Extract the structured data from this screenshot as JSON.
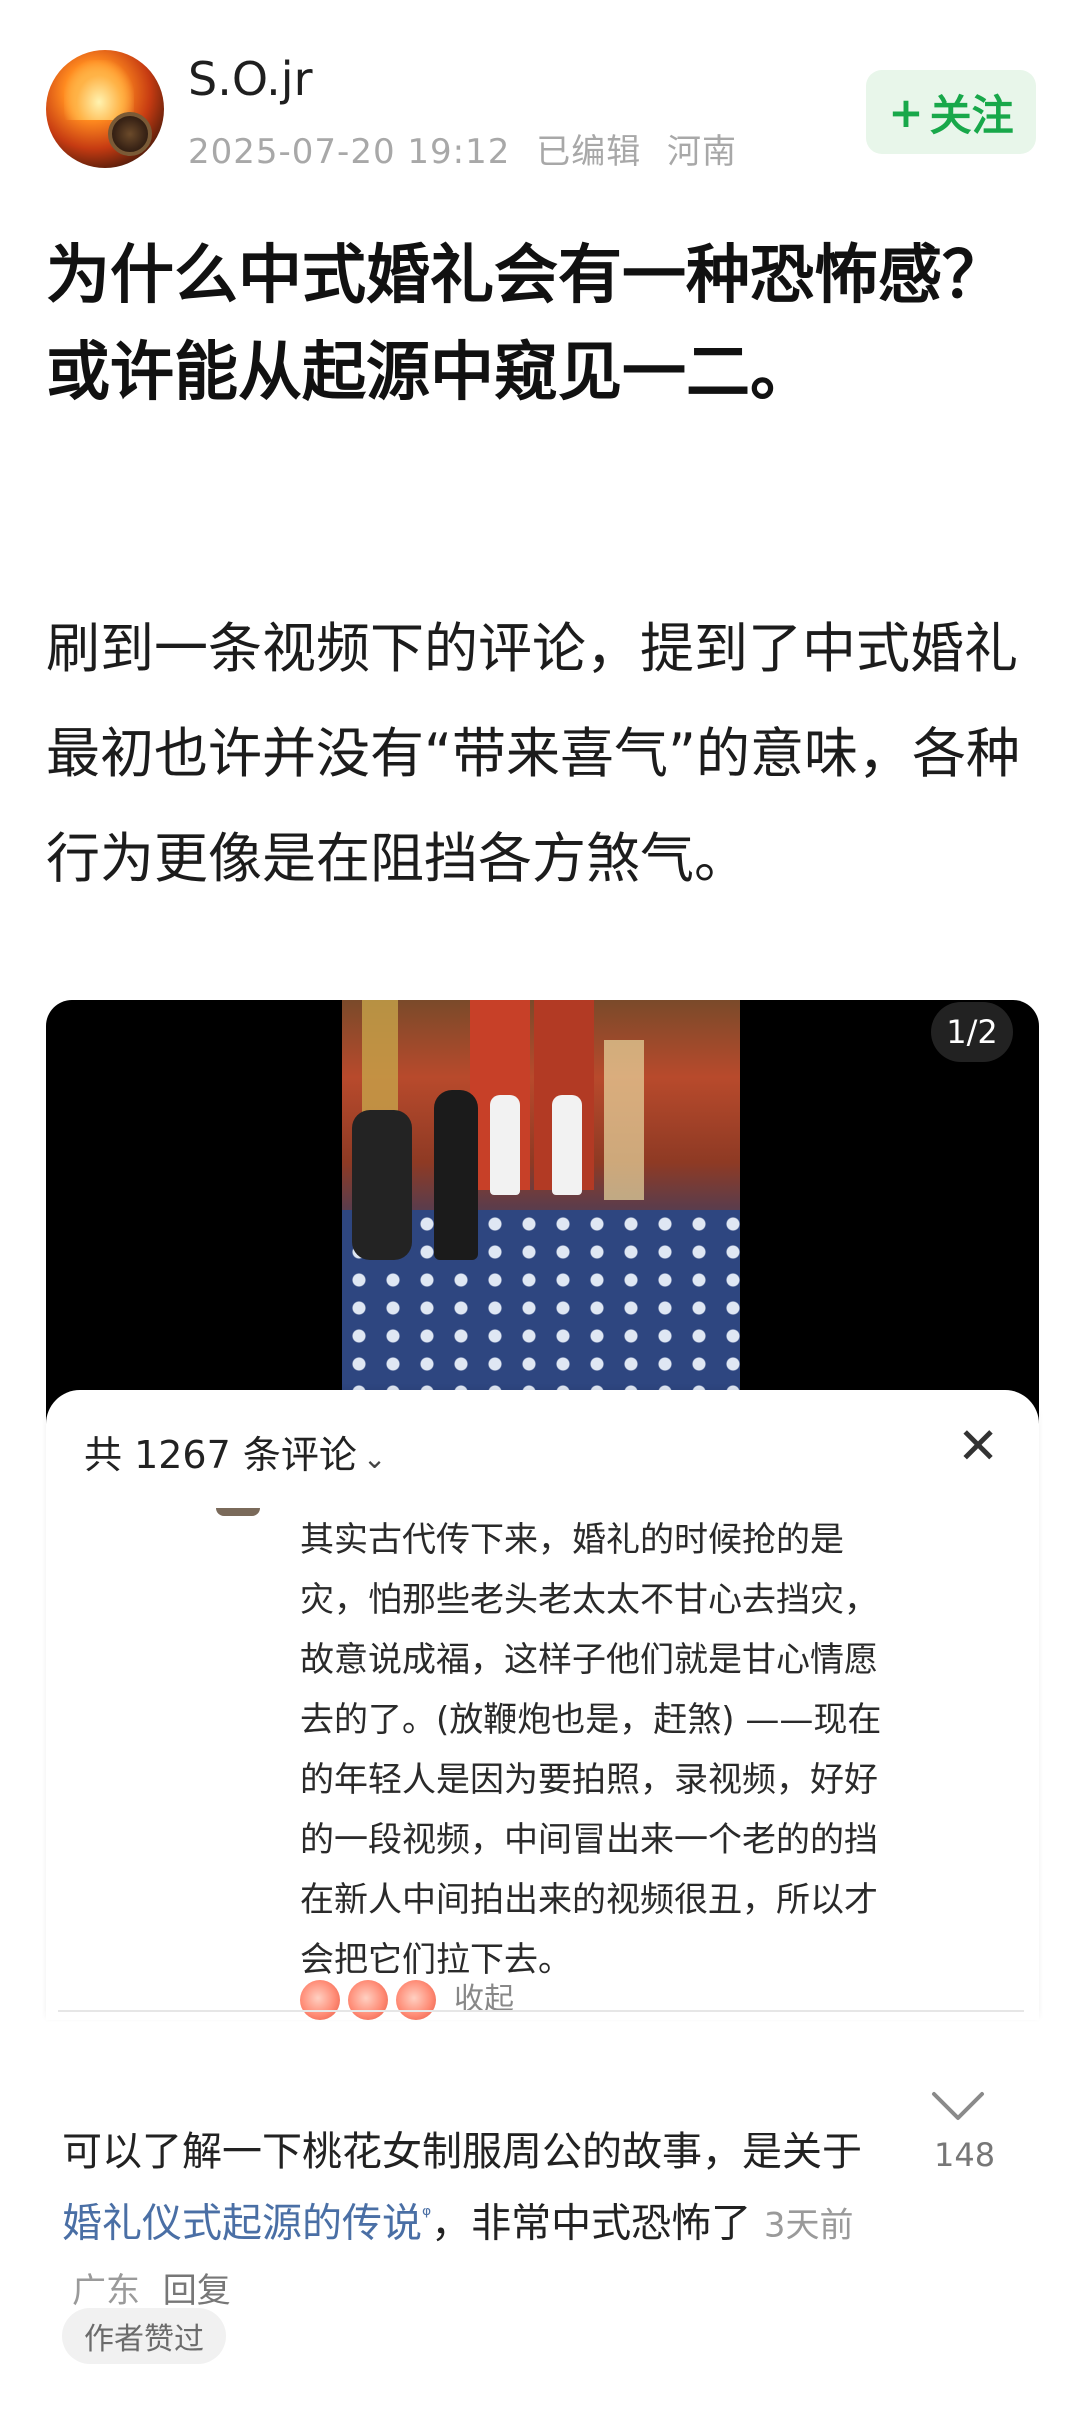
{
  "post": {
    "author": "S.O.jr",
    "timestamp": "2025-07-20 19:12",
    "edited": "已编辑",
    "location": "河南",
    "follow_label": "关注",
    "follow_plus": "+",
    "title": "为什么中式婚礼会有一种恐怖感？或许能从起源中窥见一二。",
    "body": "刷到一条视频下的评论，提到了中式婚礼最初也许并没有“带来喜气”的意味，各种行为更像是在阻挡各方煞气。",
    "media_page": "1/2"
  },
  "sheet": {
    "count": "共 1267 条评论",
    "chevron": "⌄",
    "close": "✕",
    "comment_text": "其实古代传下来，婚礼的时候抢的是灾，怕那些老头老太太不甘心去挡灾，故意说成福，这样子他们就是甘心情愿去的了。(放鞭炮也是，赶煞) ——现在的年轻人是因为要拍照，录视频，好好的一段视频，中间冒出来一个老的的挡在新人中间拍出来的视频很丑，所以才会把它们拉下去。",
    "collapse": "收起"
  },
  "reply_comment": {
    "text_before": "可以了解一下桃花女制服周公的故事，是关于 ",
    "link": "婚礼仪式起源的传说",
    "search_mark": "ᵠ",
    "text_after": "，非常中式恐怖了",
    "time": "3天前",
    "location": "广东",
    "reply": "回复",
    "likes": "148",
    "badge": "作者赞过"
  },
  "colors": {
    "follow_green": "#18a84a",
    "link_blue": "#4a6fa5",
    "meta_gray": "#a8a8a8"
  },
  "icons": {
    "like": "chevron-down-like-icon",
    "close": "close-icon",
    "search": "search-icon"
  }
}
